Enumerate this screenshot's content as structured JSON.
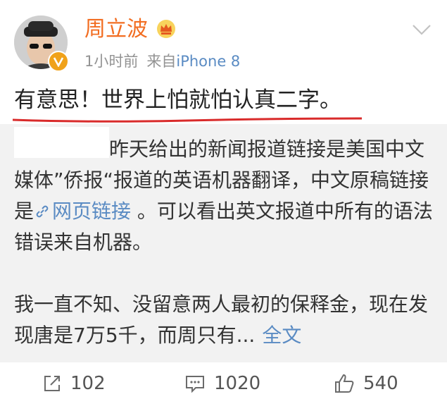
{
  "post": {
    "username": "周立波",
    "time": "1小时前",
    "source_prefix": "来自",
    "device": "iPhone 8",
    "headline": "有意思！世界上怕就怕认真二字。"
  },
  "repost": {
    "text_part1": "昨天给出的新闻报道链接是美国中文媒体”侨报“报道的英语机器翻译，中文原稿链接是",
    "link_text": "网页链接",
    "text_part2": " 。可以看出英文报道中所有的语法错误来自机器。",
    "text_para2": "我一直不知、没留意两人最初的保释金，现在发现唐是7万5千，而周只有...",
    "full_text_link": "全文"
  },
  "actions": {
    "repost_count": "102",
    "comment_count": "1020",
    "like_count": "540"
  },
  "colors": {
    "username": "#f26d21",
    "link": "#5a8bc3",
    "underline": "#d92b2b",
    "repost_bg": "#f2f2f2"
  },
  "icons": [
    "avatar",
    "verified-badge-icon",
    "crown-icon",
    "chevron-down-icon",
    "link-icon",
    "repost-icon",
    "comment-icon",
    "like-icon"
  ]
}
